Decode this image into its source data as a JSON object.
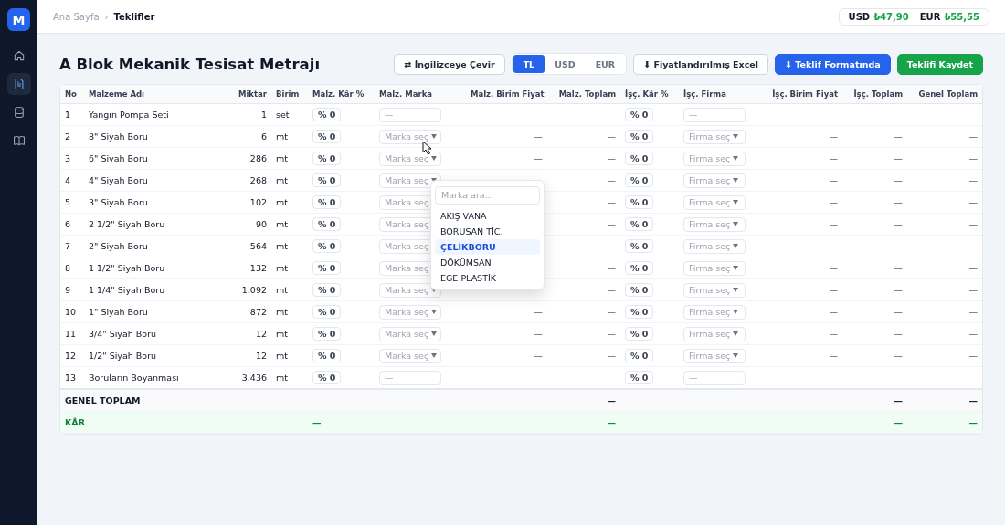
{
  "sidebar": {
    "logo": "M",
    "items": [
      {
        "kind": "home",
        "selected": false
      },
      {
        "kind": "document",
        "selected": true
      },
      {
        "kind": "database",
        "selected": false
      },
      {
        "kind": "book",
        "selected": false
      }
    ]
  },
  "breadcrumb": [
    {
      "label": "Ana Sayfa",
      "current": false
    },
    {
      "label": "Teklifler",
      "current": true
    }
  ],
  "breadcrumb_separator": "›",
  "rates": [
    {
      "code": "USD",
      "value": "₺47,90"
    },
    {
      "code": "EUR",
      "value": "₺55,55"
    }
  ],
  "title": "A Blok Mekanik Tesisat Metrajı",
  "translate_button": "⇄ İngilizceye Çevir",
  "currency_tabs": [
    {
      "label": "TL",
      "selected": true
    },
    {
      "label": "USD",
      "selected": false
    },
    {
      "label": "EUR",
      "selected": false
    }
  ],
  "buttons": [
    {
      "label": "⬇ Fiyatlandırılmış Excel",
      "kind": "outline"
    },
    {
      "label": "⬇ Teklif Formatında",
      "kind": "primary"
    },
    {
      "label": "Teklifi Kaydet",
      "kind": "success"
    }
  ],
  "table": {
    "columns": [
      "No",
      "Malzeme Adı",
      "Miktar",
      "Birim",
      "Malz. Kâr %",
      "Malz. Marka",
      "Malz. Birim Fiyat",
      "Malz. Toplam",
      "İşç. Kâr %",
      "İşç. Firma",
      "İşç. Birim Fiyat",
      "İşç. Toplam",
      "Genel Toplam"
    ],
    "rows": [
      {
        "no": "1",
        "name": "Yangın Pompa Seti",
        "qty": "1",
        "unit": "set",
        "malz_kar": "% 0",
        "marka": {
          "kind": "blank",
          "placeholder": "—"
        },
        "isc_kar": "% 0",
        "firma": {
          "kind": "blank",
          "placeholder": "—"
        }
      },
      {
        "no": "2",
        "name": "8\" Siyah Boru",
        "qty": "6",
        "unit": "mt",
        "malz_kar": "% 0",
        "marka": {
          "kind": "select",
          "placeholder": "Marka seç"
        },
        "malz_birim": "—",
        "malz_toplam": "—",
        "isc_kar": "% 0",
        "firma": {
          "kind": "select",
          "placeholder": "Firma seç"
        },
        "isc_birim": "—",
        "isc_toplam": "—",
        "genel": "—"
      },
      {
        "no": "3",
        "name": "6\" Siyah Boru",
        "qty": "286",
        "unit": "mt",
        "malz_kar": "% 0",
        "marka": {
          "kind": "select",
          "placeholder": "Marka seç"
        },
        "malz_birim": "—",
        "malz_toplam": "—",
        "isc_kar": "% 0",
        "firma": {
          "kind": "select",
          "placeholder": "Firma seç"
        },
        "isc_birim": "—",
        "isc_toplam": "—",
        "genel": "—"
      },
      {
        "no": "4",
        "name": "4\" Siyah Boru",
        "qty": "268",
        "unit": "mt",
        "malz_kar": "% 0",
        "marka": {
          "kind": "select",
          "placeholder": "Marka seç"
        },
        "malz_toplam": "—",
        "isc_kar": "% 0",
        "firma": {
          "kind": "select",
          "placeholder": "Firma seç"
        },
        "isc_birim": "—",
        "isc_toplam": "—",
        "genel": "—"
      },
      {
        "no": "5",
        "name": "3\" Siyah Boru",
        "qty": "102",
        "unit": "mt",
        "malz_kar": "% 0",
        "marka": {
          "kind": "select",
          "placeholder": "Marka seç"
        },
        "malz_toplam": "—",
        "isc_kar": "% 0",
        "firma": {
          "kind": "select",
          "placeholder": "Firma seç"
        },
        "isc_birim": "—",
        "isc_toplam": "—",
        "genel": "—"
      },
      {
        "no": "6",
        "name": "2 1/2\" Siyah Boru",
        "qty": "90",
        "unit": "mt",
        "malz_kar": "% 0",
        "marka": {
          "kind": "select",
          "placeholder": "Marka seç"
        },
        "malz_toplam": "—",
        "isc_kar": "% 0",
        "firma": {
          "kind": "select",
          "placeholder": "Firma seç"
        },
        "isc_birim": "—",
        "isc_toplam": "—",
        "genel": "—"
      },
      {
        "no": "7",
        "name": "2\" Siyah Boru",
        "qty": "564",
        "unit": "mt",
        "malz_kar": "% 0",
        "marka": {
          "kind": "select",
          "placeholder": "Marka seç"
        },
        "malz_toplam": "—",
        "isc_kar": "% 0",
        "firma": {
          "kind": "select",
          "placeholder": "Firma seç"
        },
        "isc_birim": "—",
        "isc_toplam": "—",
        "genel": "—"
      },
      {
        "no": "8",
        "name": "1 1/2\" Siyah Boru",
        "qty": "132",
        "unit": "mt",
        "malz_kar": "% 0",
        "marka": {
          "kind": "select",
          "placeholder": "Marka seç"
        },
        "malz_toplam": "—",
        "isc_kar": "% 0",
        "firma": {
          "kind": "select",
          "placeholder": "Firma seç"
        },
        "isc_birim": "—",
        "isc_toplam": "—",
        "genel": "—"
      },
      {
        "no": "9",
        "name": "1 1/4\" Siyah Boru",
        "qty": "1.092",
        "unit": "mt",
        "malz_kar": "% 0",
        "marka": {
          "kind": "select",
          "placeholder": "Marka seç"
        },
        "malz_toplam": "—",
        "isc_kar": "% 0",
        "firma": {
          "kind": "select",
          "placeholder": "Firma seç"
        },
        "isc_birim": "—",
        "isc_toplam": "—",
        "genel": "—"
      },
      {
        "no": "10",
        "name": "1\" Siyah Boru",
        "qty": "872",
        "unit": "mt",
        "malz_kar": "% 0",
        "marka": {
          "kind": "select",
          "placeholder": "Marka seç"
        },
        "malz_birim": "—",
        "malz_toplam": "—",
        "isc_kar": "% 0",
        "firma": {
          "kind": "select",
          "placeholder": "Firma seç"
        },
        "isc_birim": "—",
        "isc_toplam": "—",
        "genel": "—"
      },
      {
        "no": "11",
        "name": "3/4\" Siyah Boru",
        "qty": "12",
        "unit": "mt",
        "malz_kar": "% 0",
        "marka": {
          "kind": "select",
          "placeholder": "Marka seç"
        },
        "malz_birim": "—",
        "malz_toplam": "—",
        "isc_kar": "% 0",
        "firma": {
          "kind": "select",
          "placeholder": "Firma seç"
        },
        "isc_birim": "—",
        "isc_toplam": "—",
        "genel": "—"
      },
      {
        "no": "12",
        "name": "1/2\" Siyah Boru",
        "qty": "12",
        "unit": "mt",
        "malz_kar": "% 0",
        "marka": {
          "kind": "select",
          "placeholder": "Marka seç"
        },
        "malz_birim": "—",
        "malz_toplam": "—",
        "isc_kar": "% 0",
        "firma": {
          "kind": "select",
          "placeholder": "Firma seç"
        },
        "isc_birim": "—",
        "isc_toplam": "—",
        "genel": "—"
      },
      {
        "no": "13",
        "name": "Boruların Boyanması",
        "qty": "3.436",
        "unit": "mt",
        "malz_kar": "% 0",
        "marka": {
          "kind": "blank",
          "placeholder": "—"
        },
        "isc_kar": "% 0",
        "firma": {
          "kind": "blank",
          "placeholder": "—"
        }
      }
    ],
    "totals": [
      {
        "kind": "total",
        "label": "GENEL TOPLAM",
        "malz_toplam": "—",
        "isc_toplam": "—",
        "genel": "—"
      },
      {
        "kind": "profit",
        "label": "KÂR",
        "malz_kar": "—",
        "malz_toplam": "—",
        "isc_toplam": "—",
        "genel": "—"
      }
    ]
  },
  "dropdown": {
    "placeholder": "Marka ara...",
    "items": [
      {
        "label": "AKIŞ VANA",
        "selected": false
      },
      {
        "label": "BORUSAN TİC.",
        "selected": false
      },
      {
        "label": "ÇELİKBORU",
        "selected": true
      },
      {
        "label": "DÖKÜMSAN",
        "selected": false
      },
      {
        "label": "EGE PLASTİK",
        "selected": false
      }
    ]
  }
}
